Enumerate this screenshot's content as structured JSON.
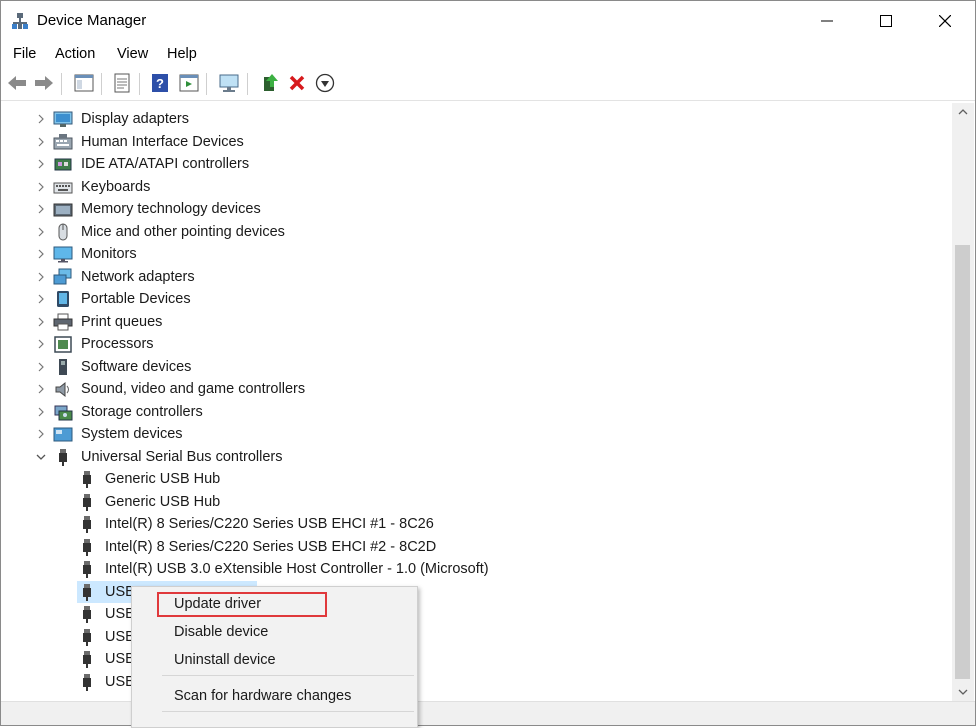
{
  "window": {
    "title": "Device Manager"
  },
  "menubar": {
    "items": [
      "File",
      "Action",
      "View",
      "Help"
    ]
  },
  "toolbar": {
    "buttons": [
      "back-icon",
      "forward-icon",
      "show-hide-console-tree-icon",
      "properties-icon",
      "help-icon",
      "action-pane-icon",
      "scan-hardware-icon",
      "update-driver-icon",
      "uninstall-icon",
      "disable-icon"
    ]
  },
  "tree": {
    "categories": [
      "Display adapters",
      "Human Interface Devices",
      "IDE ATA/ATAPI controllers",
      "Keyboards",
      "Memory technology devices",
      "Mice and other pointing devices",
      "Monitors",
      "Network adapters",
      "Portable Devices",
      "Print queues",
      "Processors",
      "Software devices",
      "Sound, video and game controllers",
      "Storage controllers",
      "System devices",
      "Universal Serial Bus controllers"
    ],
    "usb_children": [
      "Generic USB Hub",
      "Generic USB Hub",
      "Intel(R) 8 Series/C220 Series USB EHCI #1 - 8C26",
      "Intel(R) 8 Series/C220 Series USB EHCI #2 - 8C2D",
      "Intel(R) USB 3.0 eXtensible Host Controller - 1.0 (Microsoft)",
      "USB",
      "USB",
      "USB",
      "USB",
      "USB"
    ]
  },
  "context_menu": {
    "items": [
      "Update driver",
      "Disable device",
      "Uninstall device",
      "Scan for hardware changes"
    ]
  },
  "colors": {
    "selection": "#cce8ff",
    "highlight_box": "#e0393c"
  }
}
